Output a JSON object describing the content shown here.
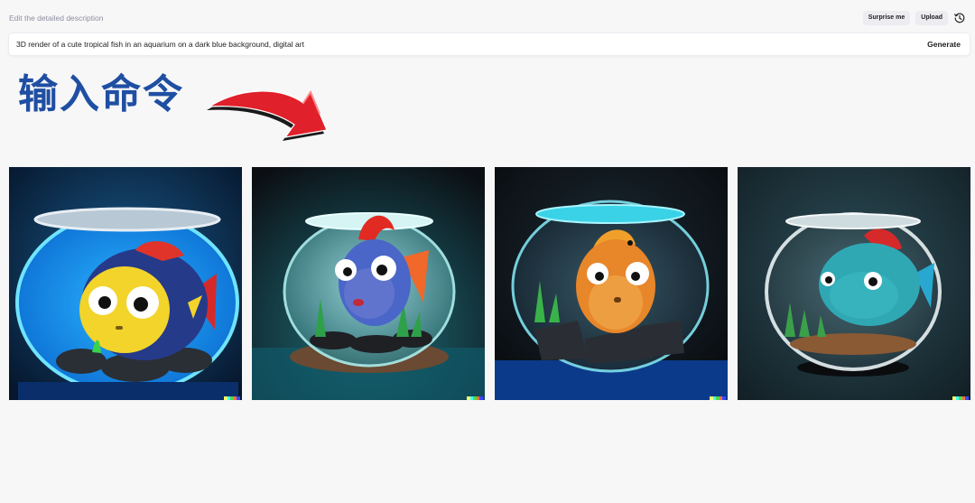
{
  "header": {
    "label": "Edit the detailed description",
    "surprise_label": "Surprise me",
    "upload_label": "Upload"
  },
  "prompt": {
    "value": "3D render of a cute tropical fish in an aquarium on a dark blue background, digital art",
    "generate_label": "Generate"
  },
  "annotation": {
    "text": "输入命令",
    "text_color": "#1f4fa3",
    "arrow_color": "#e0202a"
  },
  "results": {
    "count": 4,
    "signature_colors": [
      "#ffff66",
      "#42ffff",
      "#51da4c",
      "#ff6e3c",
      "#3c46ff"
    ]
  },
  "icons": {
    "history": "history-clock-icon"
  }
}
